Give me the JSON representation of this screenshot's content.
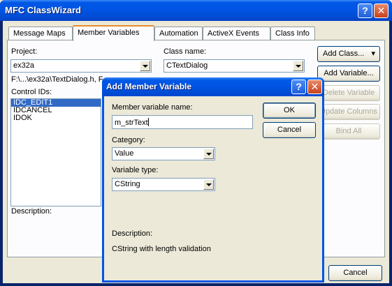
{
  "window": {
    "title": "MFC ClassWizard",
    "help": "?",
    "close": "✕"
  },
  "tabs": [
    "Message Maps",
    "Member Variables",
    "Automation",
    "ActiveX Events",
    "Class Info"
  ],
  "project": {
    "label": "Project:",
    "value": "ex32a"
  },
  "classname": {
    "label": "Class name:",
    "value": "CTextDialog"
  },
  "filepath": "F:\\...\\ex32a\\TextDialog.h, F",
  "controlids": {
    "label": "Control IDs:",
    "items": [
      "IDC_EDIT1",
      "IDCANCEL",
      "IDOK"
    ]
  },
  "description_label": "Description:",
  "buttons": {
    "add_class": "Add Class...",
    "add_variable": "Add Variable...",
    "delete_variable": "Delete Variable",
    "update_columns": "Update Columns",
    "bind_all": "Bind All",
    "cancel": "Cancel"
  },
  "dialog": {
    "title": "Add Member Variable",
    "help": "?",
    "close": "✕",
    "name_label": "Member variable name:",
    "name_value": "m_strText",
    "ok": "OK",
    "cancel": "Cancel",
    "category_label": "Category:",
    "category_value": "Value",
    "type_label": "Variable type:",
    "type_value": "CString",
    "desc_label": "Description:",
    "desc_value": "CString with length validation"
  }
}
